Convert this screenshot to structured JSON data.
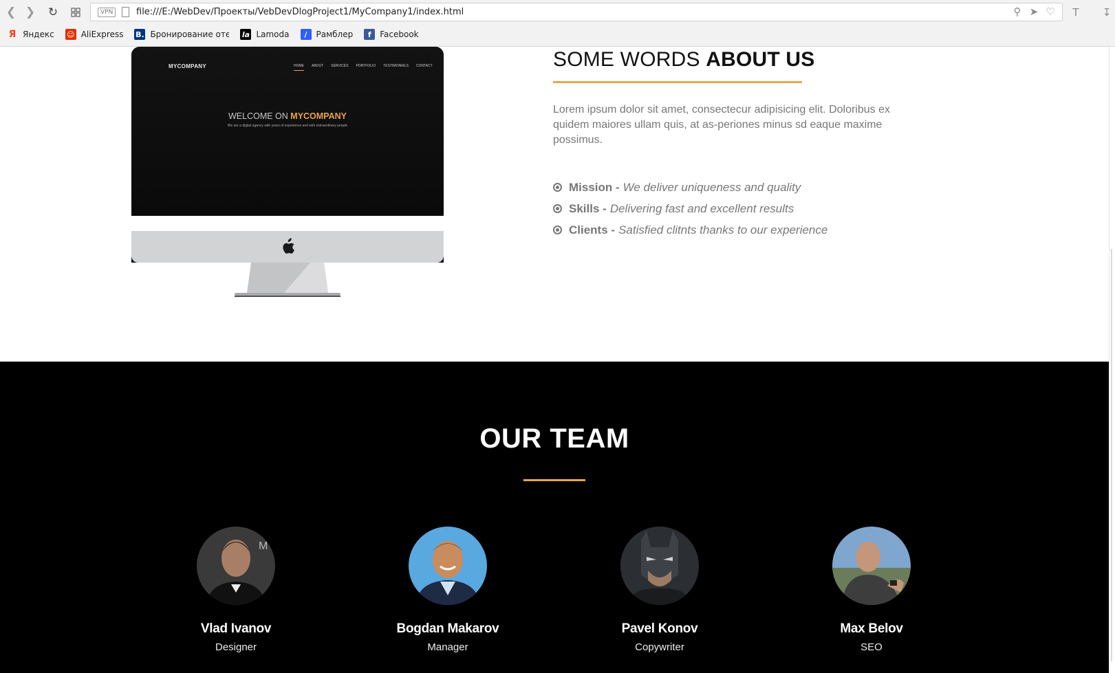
{
  "browser": {
    "vpn_label": "VPN",
    "url": "file:///E:/WebDev/Проекты/VebDevDlogProject1/MyCompany1/index.html",
    "bookmarks": [
      {
        "label": "Яндекс",
        "icon": "yandex-icon",
        "color": "#fc3f1d"
      },
      {
        "label": "AliExpress",
        "icon": "aliexpress-icon",
        "color": "#e62e04"
      },
      {
        "label": "Бронирование отеле",
        "icon": "booking-icon",
        "color": "#003580"
      },
      {
        "label": "Lamoda",
        "icon": "lamoda-icon",
        "color": "#000000"
      },
      {
        "label": "Рамблер",
        "icon": "rambler-icon",
        "color": "#315efb"
      },
      {
        "label": "Facebook",
        "icon": "facebook-icon",
        "color": "#3b5998"
      }
    ]
  },
  "mockup": {
    "logo": "MYCOMPANY",
    "nav": [
      "HOME",
      "ABOUT",
      "SERVICES",
      "PORTFOLIO",
      "TESTIMONIALS",
      "CONTACT"
    ],
    "title_pre": "WELCOME ON ",
    "title_brand": "MYCOMPANY",
    "subtitle": "We are a digital agency with years of experience and with extraordinary people"
  },
  "about": {
    "title_light": "SOME WORDS ",
    "title_bold": "ABOUT US",
    "paragraph": "Lorem ipsum dolor sit amet, consectecur adipisicing elit. Doloribus ex quidem maiores ullam quis, at as-periones minus sd eaque maxime possimus.",
    "items": [
      {
        "key": "Mission -",
        "value": "We deliver uniqueness and quality"
      },
      {
        "key": "Skills -",
        "value": "Delivering fast and excellent results"
      },
      {
        "key": "Clients -",
        "value": "Satisfied clitnts thanks to our experience"
      }
    ]
  },
  "team": {
    "title": "OUR TEAM",
    "members": [
      {
        "name": "Vlad Ivanov",
        "role": "Designer"
      },
      {
        "name": "Bogdan Makarov",
        "role": "Manager"
      },
      {
        "name": "Pavel Konov",
        "role": "Copywriter"
      },
      {
        "name": "Max Belov",
        "role": "SEO"
      }
    ]
  },
  "colors": {
    "accent": "#e8a54b",
    "team_bg": "#000000",
    "text_gray": "#777777"
  }
}
